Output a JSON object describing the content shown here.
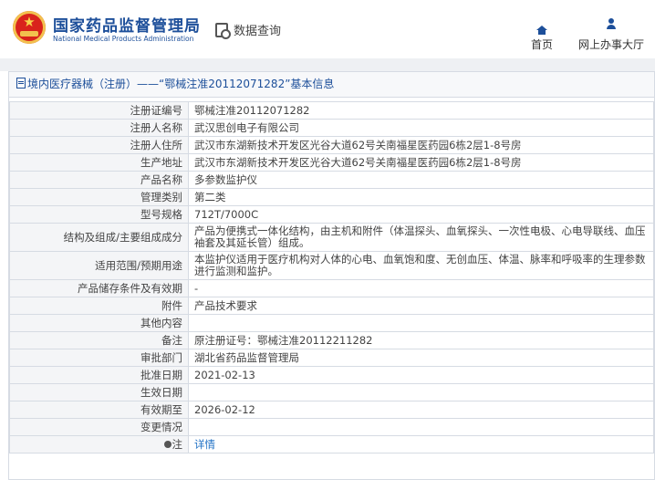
{
  "header": {
    "org_cn": "国家药品监督管理局",
    "org_en": "National Medical Products Administration",
    "query_label": "数据查询",
    "nav": [
      {
        "label": "首页",
        "icon": "home-icon"
      },
      {
        "label": "网上办事大厅",
        "icon": "user-icon"
      }
    ]
  },
  "panel": {
    "title": "境内医疗器械（注册）——“鄂械注准20112071282”基本信息"
  },
  "rows": [
    {
      "label": "注册证编号",
      "value": "鄂械注准20112071282"
    },
    {
      "label": "注册人名称",
      "value": "武汉思创电子有限公司"
    },
    {
      "label": "注册人住所",
      "value": "武汉市东湖新技术开发区光谷大道62号关南福星医药园6栋2层1-8号房"
    },
    {
      "label": "生产地址",
      "value": "武汉市东湖新技术开发区光谷大道62号关南福星医药园6栋2层1-8号房"
    },
    {
      "label": "产品名称",
      "value": "多参数监护仪"
    },
    {
      "label": "管理类别",
      "value": "第二类"
    },
    {
      "label": "型号规格",
      "value": "712T/7000C"
    },
    {
      "label": "结构及组成/主要组成成分",
      "value": "产品为便携式一体化结构，由主机和附件（体温探头、血氧探头、一次性电极、心电导联线、血压袖套及其延长管）组成。"
    },
    {
      "label": "适用范围/预期用途",
      "value": "本监护仪适用于医疗机构对人体的心电、血氧饱和度、无创血压、体温、脉率和呼吸率的生理参数进行监测和监护。"
    },
    {
      "label": "产品储存条件及有效期",
      "value": "-"
    },
    {
      "label": "附件",
      "value": "产品技术要求"
    },
    {
      "label": "其他内容",
      "value": ""
    },
    {
      "label": "备注",
      "value": "原注册证号：鄂械注准20112211282"
    },
    {
      "label": "审批部门",
      "value": "湖北省药品监督管理局"
    },
    {
      "label": "批准日期",
      "value": "2021-02-13"
    },
    {
      "label": "生效日期",
      "value": ""
    },
    {
      "label": "有效期至",
      "value": "2026-02-12"
    },
    {
      "label": "变更情况",
      "value": ""
    }
  ],
  "note": {
    "label": "注",
    "link": "详情"
  },
  "colors": {
    "brand_blue": "#1d4f9a",
    "link_blue": "#1d6fc4",
    "border": "#d6dbe3"
  }
}
